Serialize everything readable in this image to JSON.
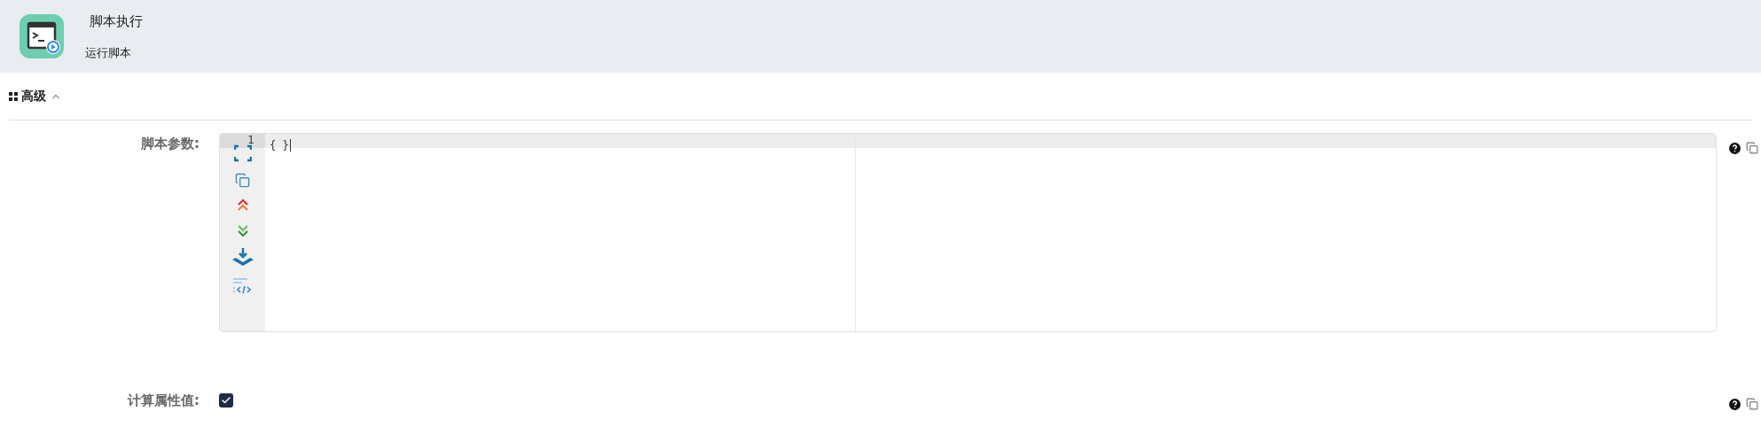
{
  "header": {
    "title": "脚本执行",
    "subtitle": "运行脚本"
  },
  "section": {
    "title": "高级",
    "expanded": true
  },
  "fields": [
    {
      "kind": "editor",
      "label": "脚本参数:",
      "line_numbers": [
        "1"
      ],
      "lines": [
        "{ }"
      ]
    },
    {
      "kind": "checkbox",
      "label": "计算属性值:",
      "checked": true
    }
  ]
}
